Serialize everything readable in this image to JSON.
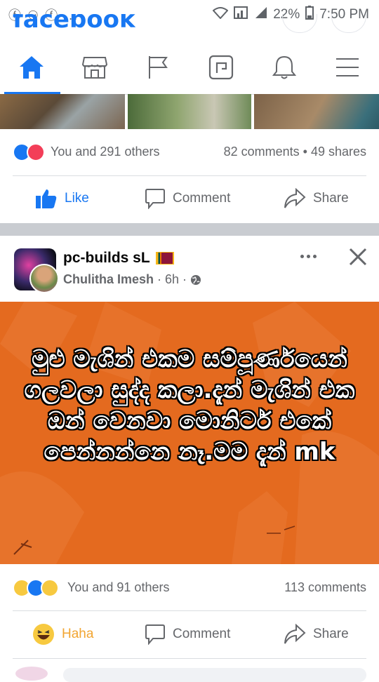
{
  "status_bar": {
    "left_icons": "ⓕ ⚇ ⓕ ...",
    "battery": "22%",
    "time": "7:50 PM"
  },
  "app_logo": "facebook",
  "nav": {
    "items": [
      "home-icon",
      "marketplace-icon",
      "pages-flag-icon",
      "groups-icon",
      "notifications-bell-icon",
      "menu-icon"
    ],
    "active_color": "#1877f2"
  },
  "post1": {
    "reactions_text": "You and 291 others",
    "comments_shares": "82 comments • 49 shares",
    "like_label": "Like",
    "comment_label": "Comment",
    "share_label": "Share"
  },
  "post2": {
    "page_name": "pc-builds sL",
    "author": "Chulitha Imesh",
    "time": "6h",
    "body_text": "මුළු මැශින් එකම සම්පූර්ණයෙන් ගලවලා සුද්ද කලා.දැන් මැශින් එක ඔන් වෙනවා මොනිටර් එකේ පෙන්නන්නෙ නෑ.මම දැන් mk",
    "reactions_text": "You and 91 others",
    "comments": "113 comments",
    "haha_label": "Haha",
    "comment_label": "Comment",
    "share_label": "Share",
    "bg_color": "#e46a1f"
  }
}
